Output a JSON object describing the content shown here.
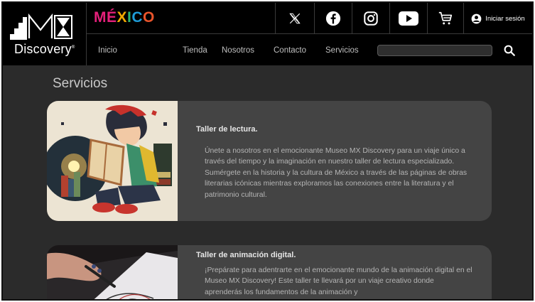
{
  "logo": {
    "wordmark": "Discovery",
    "mark": "MX"
  },
  "brand": {
    "letters": [
      "M",
      "É",
      "X",
      "I",
      "C",
      "O"
    ],
    "colors": [
      "#e4207a",
      "#e4207a",
      "#f2a900",
      "#2bb673",
      "#1e9bd7",
      "#e8542b"
    ]
  },
  "social": {
    "x": "x-icon",
    "facebook": "facebook-icon",
    "instagram": "instagram-icon",
    "youtube": "youtube-icon",
    "cart": "cart-icon"
  },
  "login": {
    "label": "Iniciar sesión"
  },
  "nav": {
    "items": [
      "Inicio",
      "Tienda",
      "Nosotros",
      "Contacto",
      "Servicios"
    ]
  },
  "search": {
    "placeholder": ""
  },
  "page": {
    "title": "Servicios"
  },
  "services": [
    {
      "title": "Taller de lectura.",
      "description": "Únete a nosotros en el emocionante Museo MX Discovery para un viaje único a través del tiempo y la imaginación en nuestro taller de lectura especializado. Sumérgete en la historia y la cultura de México a través de las páginas de obras literarias icónicas mientras exploramos las conexiones entre la literatura y el patrimonio cultural."
    },
    {
      "title": "Taller de animación digital.",
      "description": "¡Prepárate para adentrarte en el emocionante mundo de la animación digital en el Museo MX Discovery! Este taller te llevará por un viaje creativo donde aprenderás los fundamentos de la animación y"
    }
  ],
  "colors": {
    "header": "#000000",
    "background": "#2b2b2b",
    "card": "#444444"
  }
}
